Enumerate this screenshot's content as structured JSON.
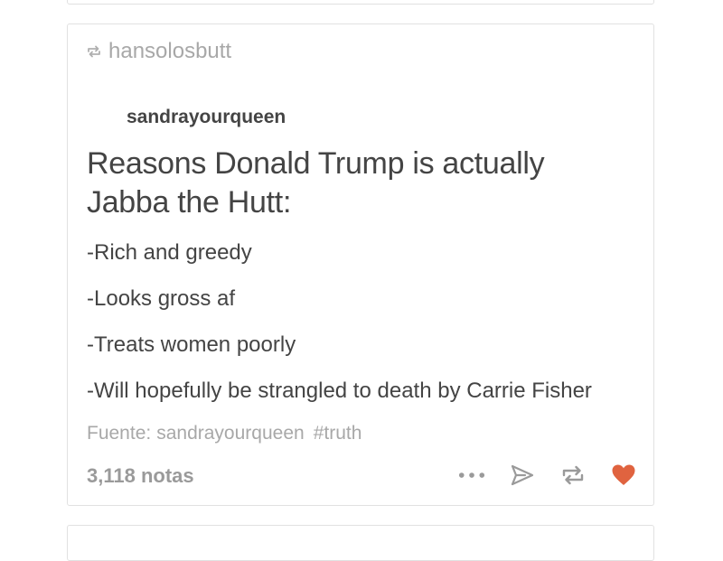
{
  "post": {
    "reblogged_by": "hansolosbutt",
    "source_user": "sandrayourqueen",
    "title": "Reasons Donald Trump is actually Jabba the Hutt:",
    "lines": [
      "-Rich and greedy",
      "-Looks gross af",
      "-Treats women poorly",
      "-Will hopefully be strangled to death by Carrie Fisher"
    ],
    "source_label": "Fuente:",
    "source_name": "sandrayourqueen",
    "tag": "#truth",
    "notes": "3,118 notas"
  },
  "icons": {
    "reblog_header": "reblog-icon",
    "more": "more-dots-icon",
    "share": "send-icon",
    "reblog": "reblog-icon",
    "like": "heart-icon"
  },
  "colors": {
    "heart": "#e0633f",
    "muted": "#a8a8a8",
    "text": "#444444"
  }
}
